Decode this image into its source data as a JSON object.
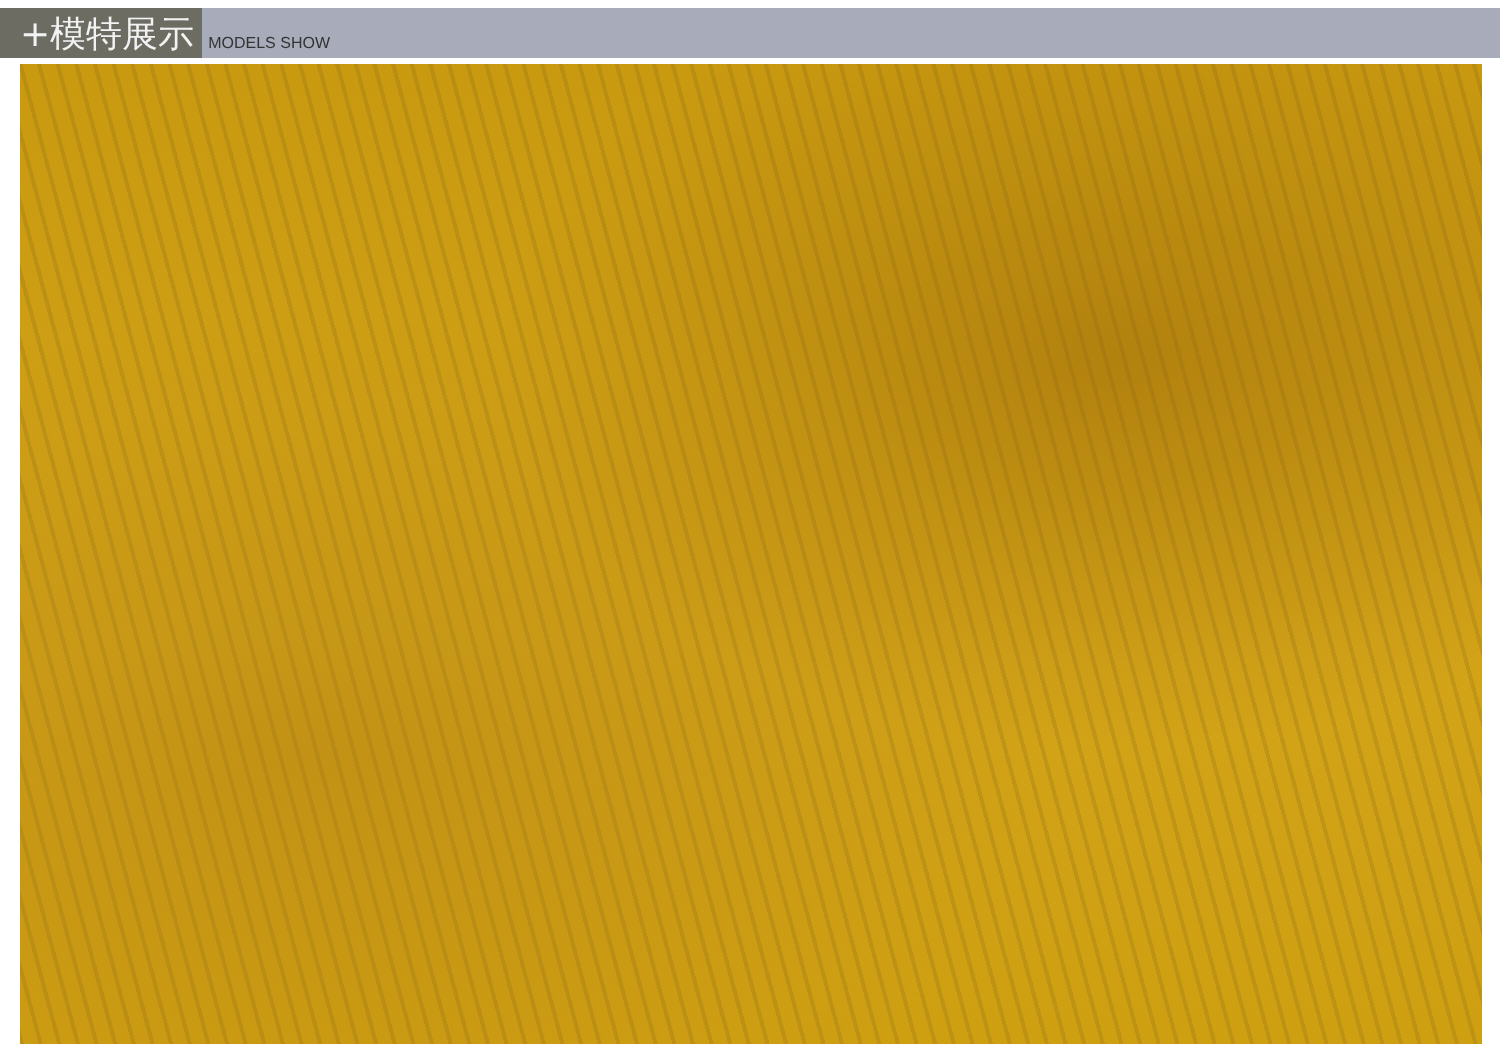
{
  "header": {
    "title": "+模特展示",
    "subtitle": "MODELS SHOW"
  }
}
